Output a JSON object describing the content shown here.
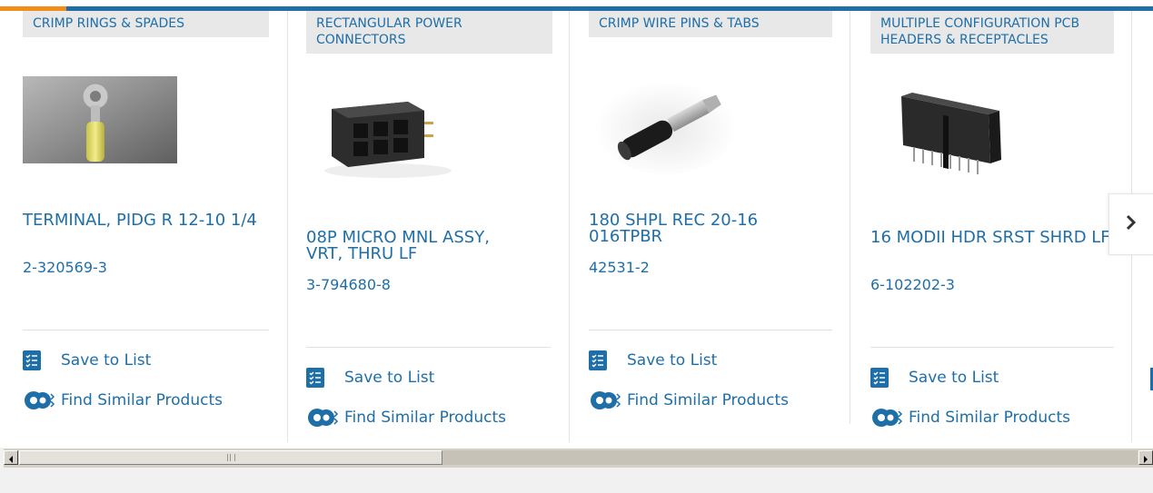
{
  "products": [
    {
      "category": "CRIMP RINGS & SPADES",
      "title": "TERMINAL, PIDG R 12-10 1/4",
      "part_number": "2-320569-3",
      "image": "ring-terminal-image",
      "save_label": "Save to List",
      "similar_label": "Find Similar Products"
    },
    {
      "category": "RECTANGULAR POWER CONNECTORS",
      "title": "08P MICRO MNL ASSY, VRT, THRU LF",
      "part_number": "3-794680-8",
      "image": "power-connector-image",
      "save_label": "Save to List",
      "similar_label": "Find Similar Products"
    },
    {
      "category": "CRIMP WIRE PINS & TABS",
      "title": "180 SHPL REC 20-16 016TPBR",
      "part_number": "42531-2",
      "image": "wire-pin-image",
      "save_label": "Save to List",
      "similar_label": "Find Similar Products"
    },
    {
      "category": "MULTIPLE CONFIGURATION PCB HEADERS & RECEPTACLES",
      "title": "16 MODII HDR SRST SHRD LF",
      "part_number": "6-102202-3",
      "image": "pcb-header-image",
      "save_label": "Save to List",
      "similar_label": "Find Similar Products"
    }
  ],
  "next_icon": "chevron-right-icon",
  "colors": {
    "accent_blue": "#1e6ea8",
    "top_bar": "#1d6fa5",
    "top_bar_accent": "#f28d1b",
    "category_bg": "#e8e8e8"
  }
}
